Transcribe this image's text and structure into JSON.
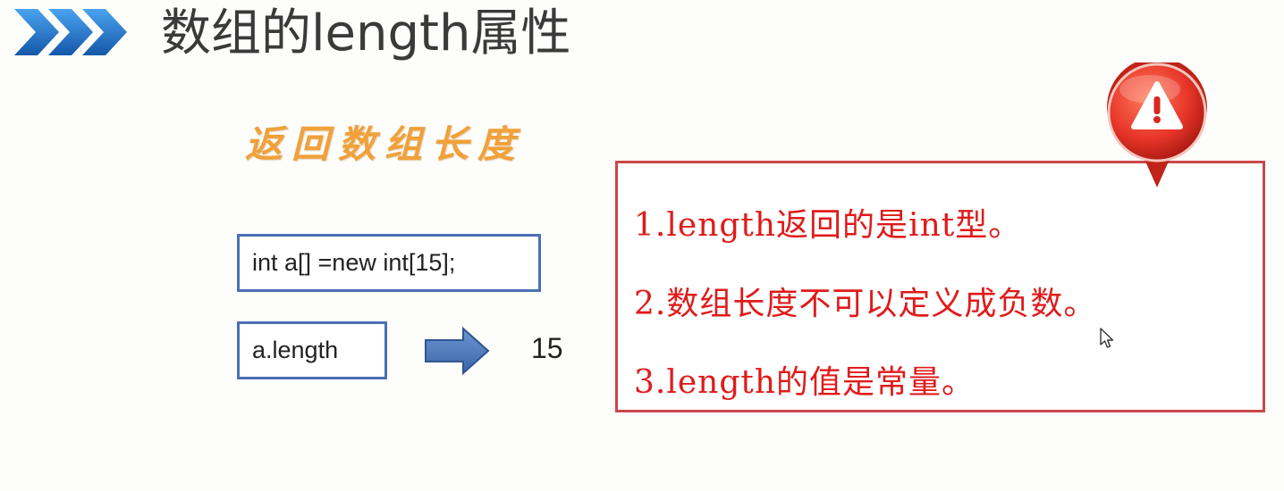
{
  "slide": {
    "title": "数组的length属性",
    "subtitle": "返回数组长度"
  },
  "code": {
    "declaration": "int a[] =new int[15];",
    "length_expr": "a.length",
    "result": "15"
  },
  "notes": [
    "1.length返回的是int型。",
    "2.数组长度不可以定义成负数。",
    "3.length的值是常量。"
  ],
  "icons": {
    "title_marker": "chevron-triple-icon",
    "arrow": "right-arrow-icon",
    "warning": "warning-icon",
    "cursor": "mouse-cursor-icon"
  },
  "colors": {
    "title_marker": "#1f6fc6",
    "subtitle": "#f0a13a",
    "code_border": "#4a6fb5",
    "arrow": "#4a78b8",
    "note_border": "#c9474b",
    "note_text": "#e01b1b",
    "warning": "#e8362a"
  }
}
